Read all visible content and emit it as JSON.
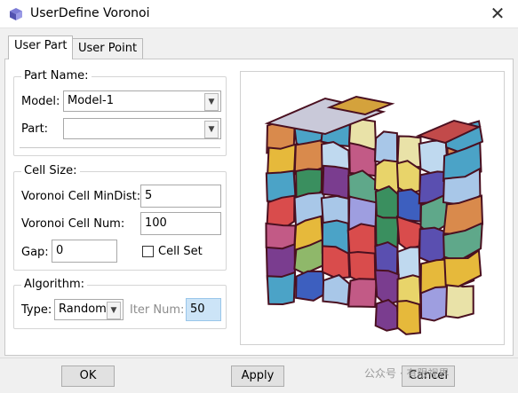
{
  "window": {
    "title": "UserDefine Voronoi",
    "close_glyph": "✕"
  },
  "tabs": [
    {
      "label": "User Part",
      "active": true
    },
    {
      "label": "User Point",
      "active": false
    }
  ],
  "part_name": {
    "group_label": "Part Name:",
    "model_label": "Model:",
    "model_value": "Model-1",
    "part_label": "Part:",
    "part_value": ""
  },
  "cell_size": {
    "group_label": "Cell Size:",
    "mindist_label": "Voronoi Cell MinDist:",
    "mindist_value": "5",
    "num_label": "Voronoi Cell Num:",
    "num_value": "100",
    "gap_label": "Gap:",
    "gap_value": "0",
    "cellset_label": "Cell Set",
    "cellset_checked": false
  },
  "algorithm": {
    "group_label": "Algorithm:",
    "type_label": "Type:",
    "type_value": "Random",
    "iter_label": "Iter Num:",
    "iter_value": "50"
  },
  "buttons": {
    "ok": "OK",
    "apply": "Apply",
    "cancel": "Cancel"
  },
  "watermark": "公众号 · 有限视界",
  "colors": {
    "accent_field": "#cce4f7",
    "disabled_text": "#8c8c8c"
  },
  "icons": {
    "app": "voronoi-app-icon",
    "dropdown": "chevron-down-icon"
  }
}
